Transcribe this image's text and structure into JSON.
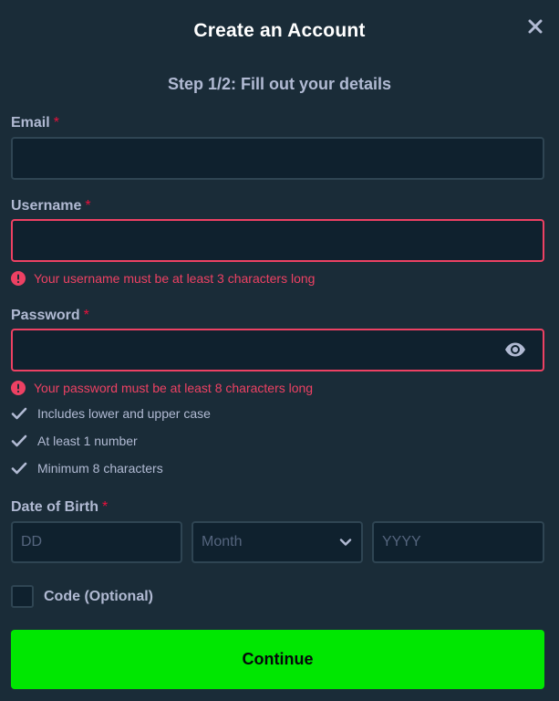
{
  "header": {
    "title": "Create an Account",
    "close_icon": "close-icon",
    "step": "Step 1/2: Fill out your details"
  },
  "form": {
    "email": {
      "label": "Email",
      "required_mark": "*",
      "value": ""
    },
    "username": {
      "label": "Username",
      "required_mark": "*",
      "value": "",
      "error": "Your username must be at least 3 characters long"
    },
    "password": {
      "label": "Password",
      "required_mark": "*",
      "value": "",
      "error": "Your password must be at least 8 characters long",
      "rules": [
        "Includes lower and upper case",
        "At least 1 number",
        "Minimum 8 characters"
      ]
    },
    "dob": {
      "label": "Date of Birth",
      "required_mark": "*",
      "day_placeholder": "DD",
      "month_placeholder": "Month",
      "year_placeholder": "YYYY"
    },
    "code": {
      "label": "Code (Optional)",
      "checked": false
    },
    "continue_label": "Continue"
  },
  "colors": {
    "background": "#1a2c38",
    "input_bg": "#0f212e",
    "error": "#ed4163",
    "accent": "#00e701"
  }
}
